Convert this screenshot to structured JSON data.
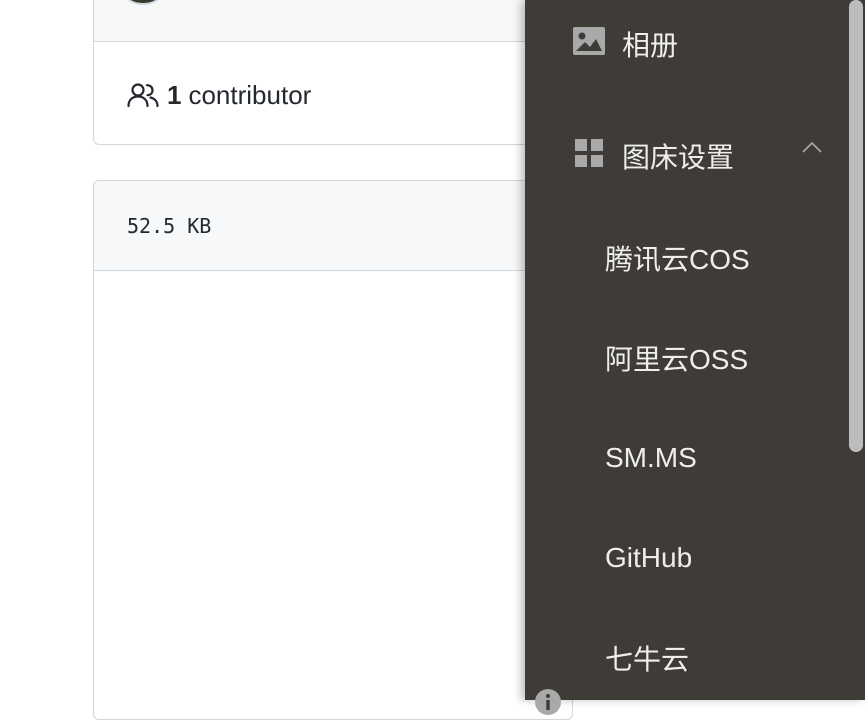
{
  "commit_card": {
    "contributors": {
      "count": "1",
      "label": "contributor",
      "icon": "people-icon"
    }
  },
  "file_card": {
    "size": "52.5 KB"
  },
  "drawer": {
    "background": "#3f3c37",
    "items": [
      {
        "icon": "image-icon",
        "label": "相册"
      },
      {
        "icon": "grid-icon",
        "label": "图床设置",
        "expanded": true,
        "chevron": "chevron-up-icon",
        "children": [
          {
            "label": "腾讯云COS"
          },
          {
            "label": "阿里云OSS"
          },
          {
            "label": "SM.MS"
          },
          {
            "label": "GitHub"
          },
          {
            "label": "七牛云"
          }
        ]
      }
    ],
    "footer_icon": "info-icon"
  }
}
